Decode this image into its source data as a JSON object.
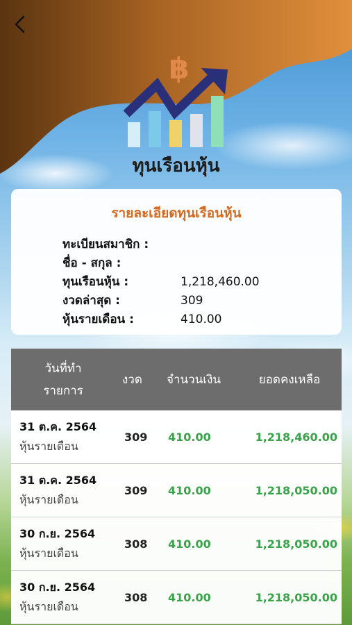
{
  "header": {
    "title": "ทุนเรือนหุ้น",
    "logo_symbol": "฿",
    "back_icon": "chevron-left-icon"
  },
  "details": {
    "title": "รายละเอียดทุนเรือนหุ้น",
    "rows": [
      {
        "label": "ทะเบียนสมาชิก :",
        "value": ""
      },
      {
        "label": "ชื่อ - สกุล :",
        "value": ""
      },
      {
        "label": "ทุนเรือนหุ้น :",
        "value": "1,218,460.00"
      },
      {
        "label": "งวดล่าสุด :",
        "value": "309"
      },
      {
        "label": "หุ้นรายเดือน :",
        "value": "410.00"
      }
    ]
  },
  "table": {
    "headers": {
      "date_line1": "วันที่ทำ",
      "date_line2": "รายการ",
      "period": "งวด",
      "amount": "จำนวนเงิน",
      "balance": "ยอดคงเหลือ"
    },
    "rows": [
      {
        "date": "31 ต.ค. 2564",
        "desc": "หุ้นรายเดือน",
        "period": "309",
        "amount": "410.00",
        "balance": "1,218,460.00"
      },
      {
        "date": "31 ต.ค. 2564",
        "desc": "หุ้นรายเดือน",
        "period": "309",
        "amount": "410.00",
        "balance": "1,218,050.00"
      },
      {
        "date": "30 ก.ย. 2564",
        "desc": "หุ้นรายเดือน",
        "period": "308",
        "amount": "410.00",
        "balance": "1,218,050.00"
      },
      {
        "date": "30 ก.ย. 2564",
        "desc": "หุ้นรายเดือน",
        "period": "308",
        "amount": "410.00",
        "balance": "1,218,050.00"
      }
    ]
  },
  "colors": {
    "header_brown": "#6b3f14",
    "header_orange": "#d98a3a",
    "accent_orange": "#d2691e",
    "amount_green": "#3aa34a",
    "table_header": "#6d6d6d"
  }
}
